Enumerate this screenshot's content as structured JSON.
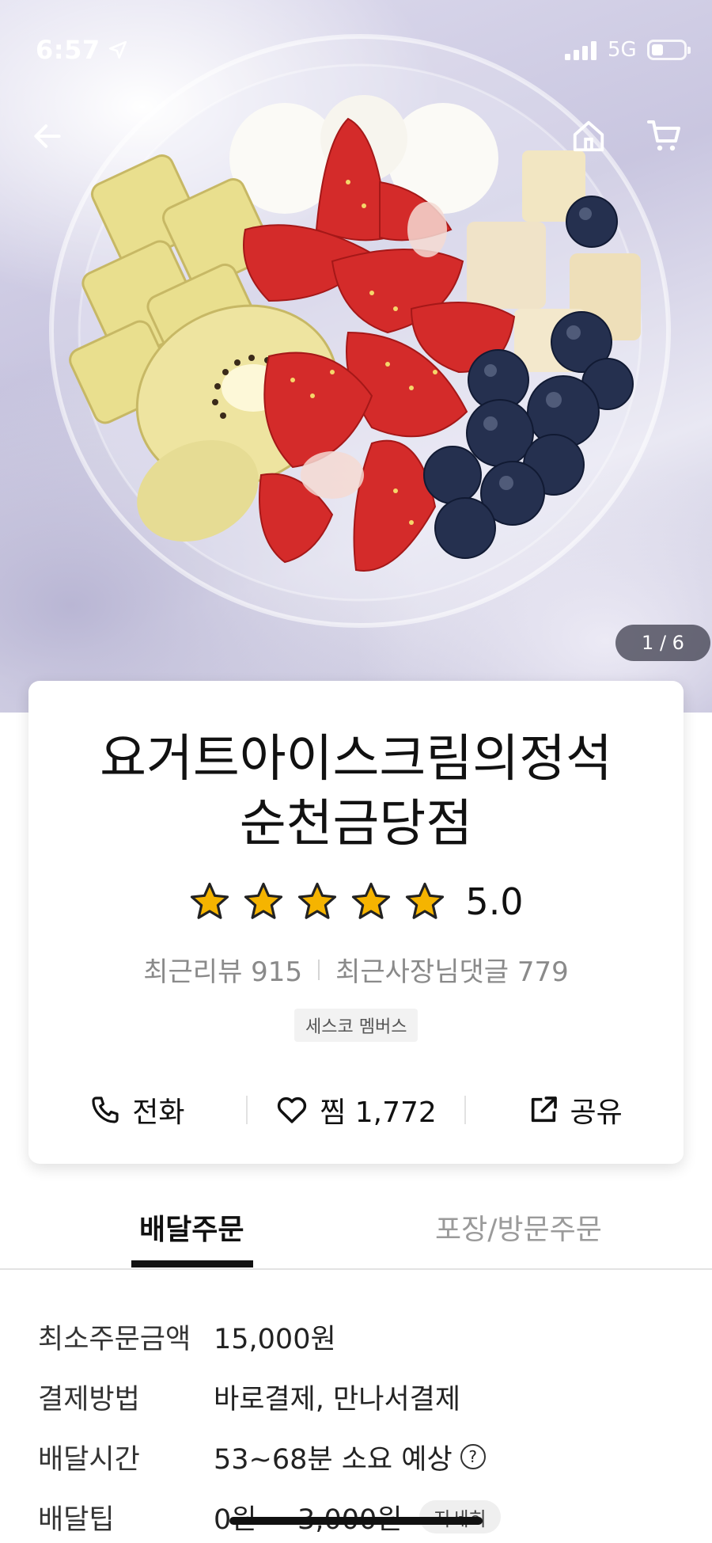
{
  "status_bar": {
    "time": "6:57",
    "network": "5G"
  },
  "hero": {
    "image_counter": "1 / 6"
  },
  "store": {
    "name_line1": "요거트아이스크림의정석",
    "name_line2": "순천금당점",
    "rating_value": 5.0,
    "rating_display": "5.0",
    "stars_filled": 5,
    "recent_reviews": "최근리뷰 915",
    "recent_owner_replies": "최근사장님댓글 779",
    "badge": "세스코 멤버스",
    "star_color": "#F5B400"
  },
  "actions": {
    "call_label": "전화",
    "favorite_label": "찜 1,772",
    "share_label": "공유"
  },
  "tabs": {
    "delivery": "배달주문",
    "takeout": "포장/방문주문"
  },
  "details": {
    "min_order_label": "최소주문금액",
    "min_order_value": "15,000원",
    "payment_label": "결제방법",
    "payment_value": "바로결제, 만나서결제",
    "delivery_time_label": "배달시간",
    "delivery_time_value": "53~68분 소요 예상",
    "delivery_tip_label": "배달팁",
    "delivery_tip_value": "0원 ~ 3,000원",
    "more_label": "자세히"
  }
}
